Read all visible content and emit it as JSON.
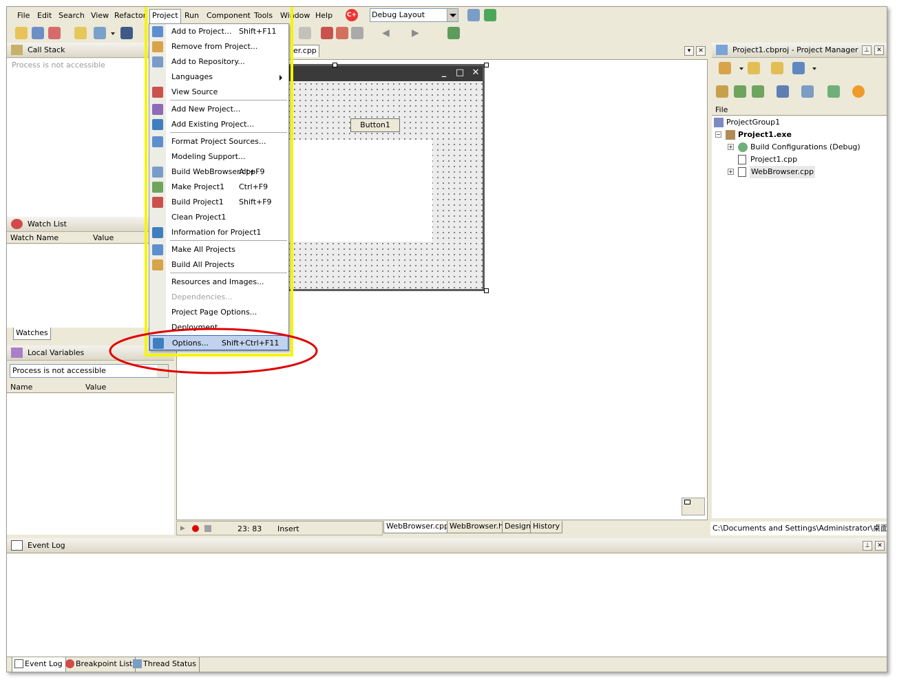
{
  "menubar": {
    "items": [
      "File",
      "Edit",
      "Search",
      "View",
      "Refactor",
      "Project",
      "Run",
      "Component",
      "Tools",
      "Window",
      "Help"
    ],
    "layout_combo": "Debug Layout"
  },
  "call_stack": {
    "title": "Call Stack",
    "message": "Process is not accessible"
  },
  "editor": {
    "tab_fragment": "er.cpp",
    "button_label": "Button1",
    "status": {
      "position": "23:  83",
      "mode": "Insert"
    },
    "view_tabs": [
      "WebBrowser.cpp",
      "WebBrowser.h",
      "Design",
      "History"
    ]
  },
  "project_menu": {
    "items": [
      {
        "label": "Add to Project...",
        "shortcut": "Shift+F11",
        "icon": "add-to-project-icon"
      },
      {
        "label": "Remove from Project...",
        "shortcut": "",
        "icon": "remove-from-project-icon"
      },
      {
        "label": "Add to Repository...",
        "shortcut": "",
        "icon": "repository-icon"
      },
      {
        "label": "Languages",
        "shortcut": "",
        "icon": "",
        "submenu": true
      },
      {
        "label": "View Source",
        "shortcut": "",
        "icon": "view-source-icon"
      },
      {
        "label": "Add New Project...",
        "shortcut": "",
        "icon": "new-project-icon"
      },
      {
        "label": "Add Existing Project...",
        "shortcut": "",
        "icon": "existing-project-icon"
      },
      {
        "label": "Format Project Sources...",
        "shortcut": "",
        "icon": "format-sources-icon"
      },
      {
        "label": "Modeling Support...",
        "shortcut": "",
        "icon": ""
      },
      {
        "label": "Build WebBrowser.cpp",
        "shortcut": "Alt+F9",
        "icon": "build-file-icon"
      },
      {
        "label": "Make Project1",
        "shortcut": "Ctrl+F9",
        "icon": "make-project-icon"
      },
      {
        "label": "Build Project1",
        "shortcut": "Shift+F9",
        "icon": "build-project-icon"
      },
      {
        "label": "Clean Project1",
        "shortcut": "",
        "icon": ""
      },
      {
        "label": "Information for Project1",
        "shortcut": "",
        "icon": "information-icon"
      },
      {
        "label": "Make All Projects",
        "shortcut": "",
        "icon": "make-all-icon"
      },
      {
        "label": "Build All Projects",
        "shortcut": "",
        "icon": "build-all-icon"
      },
      {
        "label": "Resources and Images...",
        "shortcut": "",
        "icon": ""
      },
      {
        "label": "Dependencies...",
        "shortcut": "",
        "icon": "",
        "disabled": true
      },
      {
        "label": "Project Page Options...",
        "shortcut": "",
        "icon": ""
      },
      {
        "label": "Deployment",
        "shortcut": "",
        "icon": ""
      },
      {
        "label": "Options...",
        "shortcut": "Shift+Ctrl+F11",
        "icon": "options-icon",
        "selected": true
      }
    ]
  },
  "watch_list": {
    "title": "Watch List",
    "columns": [
      "Watch Name",
      "Value"
    ],
    "tab": "Watches"
  },
  "local_variables": {
    "title": "Local Variables",
    "combo": "Process is not accessible",
    "columns": [
      "Name",
      "Value"
    ]
  },
  "project_manager": {
    "title": "Project1.cbproj - Project Manager",
    "column": "File",
    "tree": [
      "ProjectGroup1",
      "Project1.exe",
      "Build Configurations (Debug)",
      "Project1.cpp",
      "WebBrowser.cpp"
    ],
    "path": "C:\\Documents and Settings\\Administrator\\桌面\\甲板"
  },
  "event_log": {
    "title": "Event Log",
    "tabs": [
      "Event Log",
      "Breakpoint List",
      "Thread Status"
    ]
  },
  "colors": {
    "highlight_yellow": "#f5f500",
    "annotation_red": "#e00000",
    "menu_selected": "#c1d2ee"
  }
}
